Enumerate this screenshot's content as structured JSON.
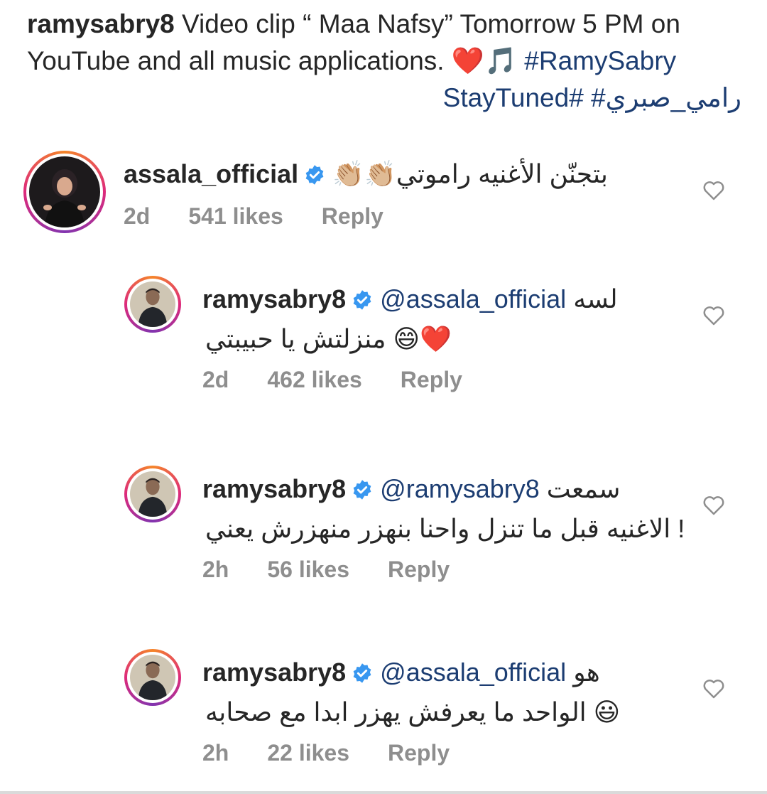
{
  "caption": {
    "username": "ramysabry8",
    "text": " Video clip “ Maa Nafsy” Tomorrow 5 PM on YouTube and all music applications. ",
    "heart_emoji": "❤️",
    "note_emoji": "🎵",
    "hashtag_main": "#RamySabry",
    "line3_hashtags": "StayTuned# #رامي_صبري"
  },
  "comments": [
    {
      "username": "assala_official",
      "line1": "👏🏼👏🏼بتجنّن الأغنيه راموتي",
      "line2": "",
      "time": "2d",
      "likes": "541 likes",
      "reply": "Reply"
    },
    {
      "username": "ramysabry8",
      "mention": "@assala_official",
      "line1_text": "لسه",
      "line2": "منزلتش يا حبيبتي 😄❤️",
      "time": "2d",
      "likes": "462 likes",
      "reply": "Reply"
    },
    {
      "username": "ramysabry8",
      "mention": "@ramysabry8",
      "line1_text": "سمعت",
      "line2": "الاغنيه قبل ما تنزل واحنا بنهزر منهزرش يعني !",
      "time": "2h",
      "likes": "56 likes",
      "reply": "Reply"
    },
    {
      "username": "ramysabry8",
      "mention": "@assala_official",
      "line1_text": "هو",
      "line2": "الواحد ما يعرفش يهزر ابدا مع صحابه 😃",
      "time": "2h",
      "likes": "22 likes",
      "reply": "Reply"
    }
  ],
  "icons": {
    "verified": "verified-badge-icon",
    "like": "heart-outline-icon"
  },
  "colors": {
    "hashtag": "#1c3d72",
    "verified": "#3897f0",
    "meta_text": "#8e8e8e",
    "body_text": "#262626"
  }
}
